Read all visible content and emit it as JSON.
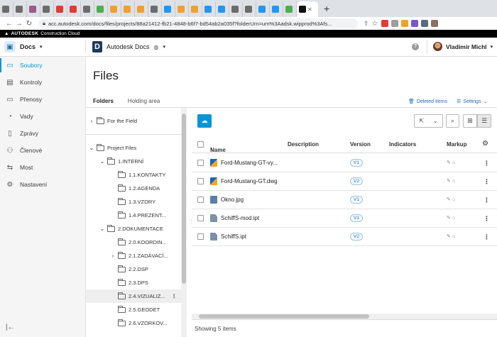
{
  "browser": {
    "tab_count_favicon_colors": [
      "#6c6c6c",
      "#6c6c6c",
      "#9c5b8a",
      "#6c6c6c",
      "#e53935",
      "#e53935",
      "#6c6c6c",
      "#4caf50",
      "#f0a030",
      "#f0a030",
      "#f0a030",
      "#6c6c6c",
      "#2196f3",
      "#f0a030",
      "#f0a030",
      "#2196f3",
      "#2196f3",
      "#6c6c6c",
      "#6c6c6c",
      "#2196f3",
      "#2196f3",
      "#4caf50"
    ],
    "active_tab_close": "✕",
    "new_tab": "+",
    "url": "acc.autodesk.com/docs/files/projects/88a21412-fb21-4848-b6f7-bd54ab2a035f?folderUrn=urn%3Aadsk.wipprod%3Afs..."
  },
  "brand_bar": {
    "logo": "AUTODESK",
    "product": "Construction Cloud"
  },
  "header": {
    "product_name": "Docs",
    "project_name": "Autodesk Docs",
    "user_name": "Vladimír Michl",
    "help": "?"
  },
  "nav": {
    "items": [
      {
        "label": "Soubory",
        "icon": "folder-icon",
        "glyph": "▭",
        "active": true
      },
      {
        "label": "Kontroly",
        "icon": "reviews-icon",
        "glyph": "▤"
      },
      {
        "label": "Přenosy",
        "icon": "transmittals-icon",
        "glyph": "▭"
      },
      {
        "label": "Vady",
        "icon": "issues-icon",
        "glyph": "◔"
      },
      {
        "label": "Zprávy",
        "icon": "reports-icon",
        "glyph": "▯"
      },
      {
        "label": "Členové",
        "icon": "members-icon",
        "glyph": "⚇"
      },
      {
        "label": "Most",
        "icon": "bridge-icon",
        "glyph": "⇆"
      },
      {
        "label": "Nastavení",
        "icon": "settings-icon",
        "glyph": "⚙"
      }
    ],
    "collapse": "|←"
  },
  "page": {
    "title": "Files",
    "tabs": [
      "Folders",
      "Holding area"
    ],
    "deleted_items": "Deleted Items",
    "settings": "Settings"
  },
  "tree": [
    {
      "label": "For the Field",
      "chevron": "›",
      "indent": 0
    },
    {
      "label": "Project Files",
      "chevron": "⌄",
      "indent": 0
    },
    {
      "label": "1.INTERNÍ",
      "chevron": "⌄",
      "indent": 1
    },
    {
      "label": "1.1.KONTAKTY",
      "chevron": "",
      "indent": 2
    },
    {
      "label": "1.2.AGENDA",
      "chevron": "",
      "indent": 2
    },
    {
      "label": "1.3.VZORY",
      "chevron": "",
      "indent": 2
    },
    {
      "label": "1.4.PREZENT...",
      "chevron": "",
      "indent": 2
    },
    {
      "label": "2.DOKUMENTACE",
      "chevron": "⌄",
      "indent": 1
    },
    {
      "label": "2.0.KOORDIN...",
      "chevron": "",
      "indent": 2
    },
    {
      "label": "2.1.ZADÁVACÍ...",
      "chevron": "›",
      "indent": 2
    },
    {
      "label": "2.2.DSP",
      "chevron": "",
      "indent": 2
    },
    {
      "label": "2.3.DPS",
      "chevron": "",
      "indent": 2
    },
    {
      "label": "2.4.VIZUALIZ...",
      "chevron": "",
      "indent": 2,
      "selected": true
    },
    {
      "label": "2.5.GEODET",
      "chevron": "",
      "indent": 2
    },
    {
      "label": "2.6.VZORKOV...",
      "chevron": "",
      "indent": 2
    }
  ],
  "table": {
    "columns": [
      "Name",
      "Description",
      "Version",
      "Indicators",
      "Markup"
    ],
    "sort_indicator": "↑",
    "rows": [
      {
        "name": "Ford-Mustang-GT-vy...",
        "type": "dwg",
        "version": "V1"
      },
      {
        "name": "Ford-Mustang-GT.dwg",
        "type": "dwg",
        "version": "V2"
      },
      {
        "name": "Okno.jpg",
        "type": "jpg",
        "version": "V1"
      },
      {
        "name": "SchiffS-mod.ipt",
        "type": "ipt",
        "version": "V1"
      },
      {
        "name": "SchiffS.ipt",
        "type": "ipt",
        "version": "V2"
      }
    ]
  },
  "footer": {
    "status": "Showing 5 items"
  },
  "colors": {
    "accent": "#0696d7",
    "link": "#1a6fb4"
  }
}
